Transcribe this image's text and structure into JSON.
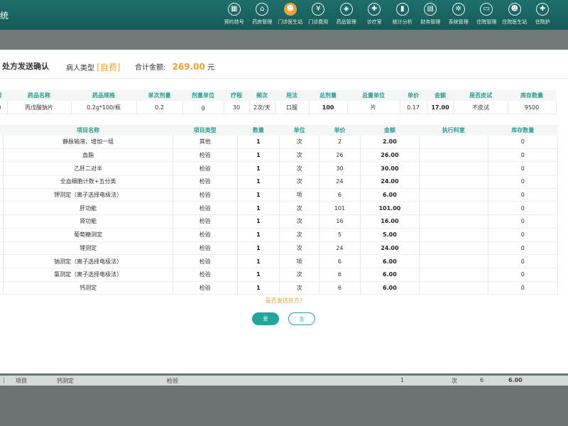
{
  "header": {
    "title_fragment": "统",
    "nav": [
      {
        "label": "预约挂号",
        "icon": "calendar-icon"
      },
      {
        "label": "药房管理",
        "icon": "house-icon"
      },
      {
        "label": "门诊医生站",
        "icon": "doctor-icon",
        "active": true
      },
      {
        "label": "门诊费用",
        "icon": "yen-icon"
      },
      {
        "label": "药品管理",
        "icon": "pill-icon"
      },
      {
        "label": "诊疗室",
        "icon": "user-plus-icon"
      },
      {
        "label": "统计分析",
        "icon": "bar-chart-icon"
      },
      {
        "label": "财务管理",
        "icon": "ledger-icon"
      },
      {
        "label": "系统管理",
        "icon": "gear-icon"
      },
      {
        "label": "住院管理",
        "icon": "bed-icon"
      },
      {
        "label": "住院医生站",
        "icon": "doctor-icon"
      },
      {
        "label": "住院护",
        "icon": "nurse-icon"
      }
    ]
  },
  "modal": {
    "title": "处方发送确认",
    "patient_type_label": "病人类型",
    "patient_type_value": "[自费]",
    "total_label": "合计金额:",
    "total_amount": "269.00",
    "total_unit": "元",
    "drug_table": {
      "headers": [
        "号",
        "药品名称",
        "药品规格",
        "单次剂量",
        "剂量单位",
        "疗程",
        "频次",
        "用法",
        "总剂量",
        "总量单位",
        "单价",
        "金额",
        "是否皮试",
        "库存数量"
      ],
      "rows": [
        [
          "0",
          "丙戊酸钠片",
          "0.2g*100/瓶",
          "0.2",
          "g",
          "30",
          "2次/天",
          "口服",
          "100",
          "片",
          "0.17",
          "17.00",
          "不皮试",
          "9500"
        ]
      ]
    },
    "item_table": {
      "headers": [
        "",
        "项目名称",
        "项目类型",
        "数量",
        "单位",
        "单价",
        "金额",
        "执行科室",
        "库存数量"
      ],
      "rows": [
        [
          "",
          "静脉输液、增加一组",
          "其他",
          "1",
          "次",
          "2",
          "2.00",
          "",
          "0"
        ],
        [
          "",
          "血脂",
          "检验",
          "1",
          "次",
          "26",
          "26.00",
          "",
          "0"
        ],
        [
          "",
          "乙肝二对半",
          "检验",
          "1",
          "次",
          "30",
          "30.00",
          "",
          "0"
        ],
        [
          "",
          "全血细胞计数+五分类",
          "检验",
          "1",
          "次",
          "24",
          "24.00",
          "",
          "0"
        ],
        [
          "",
          "钾测定（离子选择电极法）",
          "检验",
          "1",
          "项",
          "6",
          "6.00",
          "",
          "0"
        ],
        [
          "",
          "肝功能",
          "检验",
          "1",
          "次",
          "101",
          "101.00",
          "",
          "0"
        ],
        [
          "",
          "肾功能",
          "检验",
          "1",
          "次",
          "16",
          "16.00",
          "",
          "0"
        ],
        [
          "",
          "葡萄糖测定",
          "检验",
          "1",
          "次",
          "5",
          "5.00",
          "",
          "0"
        ],
        [
          "",
          "锂测定",
          "检验",
          "1",
          "次",
          "24",
          "24.00",
          "",
          "0"
        ],
        [
          "",
          "钠测定（离子选择电极法）",
          "检验",
          "1",
          "项",
          "6",
          "6.00",
          "",
          "0"
        ],
        [
          "",
          "氯测定（离子选择电极法）",
          "检验",
          "1",
          "次",
          "6",
          "6.00",
          "",
          "0"
        ],
        [
          "",
          "钙测定",
          "检验",
          "1",
          "次",
          "6",
          "6.00",
          "",
          "0"
        ]
      ]
    },
    "confirm_question": "是否发送处方?",
    "yes_label": "是",
    "no_label": "否"
  },
  "background_row": {
    "c1": "项目",
    "c2": "钙测定",
    "c3": "检验",
    "c4": "1",
    "c5": "次",
    "c6": "6",
    "c7": "6.00"
  }
}
